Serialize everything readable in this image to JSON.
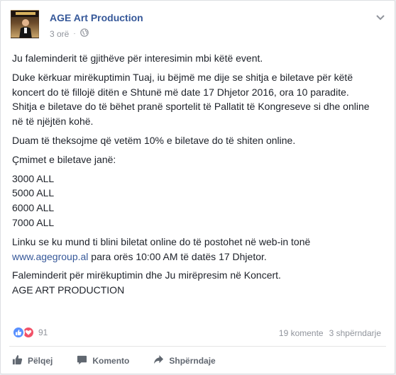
{
  "post": {
    "page_name": "AGE Art Production",
    "time": "3 orë",
    "separator": "·",
    "paragraphs": [
      "Ju faleminderit të gjithëve për interesimin mbi këtë event.",
      "Duke kërkuar mirëkuptimin Tuaj, iu bëjmë me dije se shitja e biletave për këtë koncert do të fillojë ditën e Shtunë më date 17 Dhjetor 2016, ora 10 paradite.",
      "Shitja e biletave do të bëhet pranë sportelit të Pallatit të Kongreseve si dhe online në të njëjtën kohë.",
      "Duam të theksojme që vetëm 10% e biletave do të shiten online.",
      "Çmimet e biletave janë:"
    ],
    "prices": [
      "3000 ALL",
      "5000 ALL",
      "6000 ALL",
      "7000 ALL"
    ],
    "link_line_1": "Linku se ku mund ti blini biletat online do të postohet në web-in tonë",
    "link_url": "www.agegroup.al",
    "link_line_2": " para orës 10:00 AM të datës 17 Dhjetor.",
    "closing_1": "Faleminderit për mirëkuptimin dhe Ju mirëpresim në Koncert.",
    "closing_2": "AGE ART PRODUCTION"
  },
  "stats": {
    "reactions_count": "91",
    "comments": "19 komente",
    "shares": "3 shpërndarje"
  },
  "actions": {
    "like": "Pëlqej",
    "comment": "Komento",
    "share": "Shpërndaje"
  },
  "colors": {
    "link": "#365899",
    "like": "#5890ff",
    "love": "#f25268"
  },
  "icons": [
    "globe-icon",
    "chevron-down-icon",
    "like-reaction-icon",
    "love-reaction-icon",
    "thumbs-up-icon",
    "comment-icon",
    "share-icon"
  ]
}
